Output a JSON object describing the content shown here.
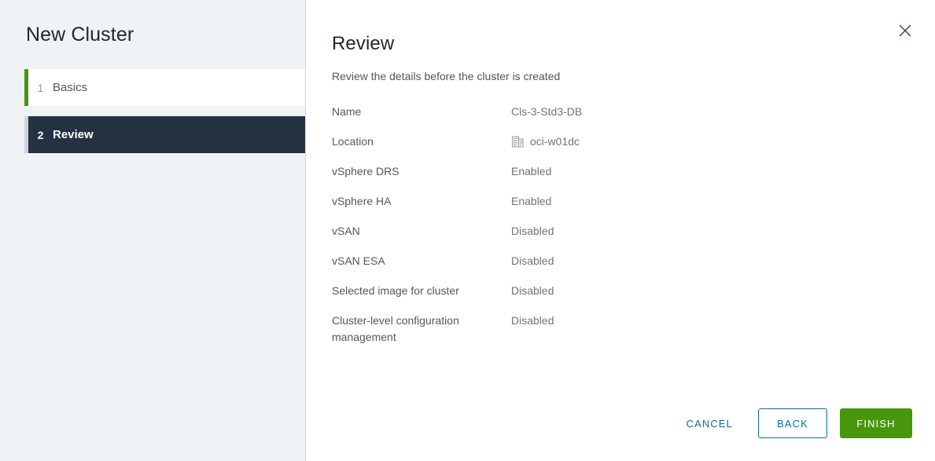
{
  "wizard": {
    "title": "New Cluster",
    "steps": [
      {
        "num": "1",
        "label": "Basics",
        "state": "completed"
      },
      {
        "num": "2",
        "label": "Review",
        "state": "active"
      }
    ]
  },
  "main": {
    "title": "Review",
    "subtitle": "Review the details before the cluster is created",
    "close_icon": "close-icon",
    "details": [
      {
        "label": "Name",
        "value": "Cls-3-Std3-DB"
      },
      {
        "label": "Location",
        "value": "oci-w01dc",
        "icon": "datacenter-icon"
      },
      {
        "label": "vSphere DRS",
        "value": "Enabled"
      },
      {
        "label": "vSphere HA",
        "value": "Enabled"
      },
      {
        "label": "vSAN",
        "value": "Disabled"
      },
      {
        "label": "vSAN ESA",
        "value": "Disabled"
      },
      {
        "label": "Selected image for cluster",
        "value": "Disabled"
      },
      {
        "label": "Cluster-level configuration management",
        "value": "Disabled"
      }
    ]
  },
  "footer": {
    "cancel_label": "CANCEL",
    "back_label": "BACK",
    "finish_label": "FINISH"
  },
  "colors": {
    "accent_green": "#48960c",
    "accent_blue": "#0072a3",
    "active_step_bg": "#243142",
    "sidebar_bg": "#eff3f6"
  }
}
